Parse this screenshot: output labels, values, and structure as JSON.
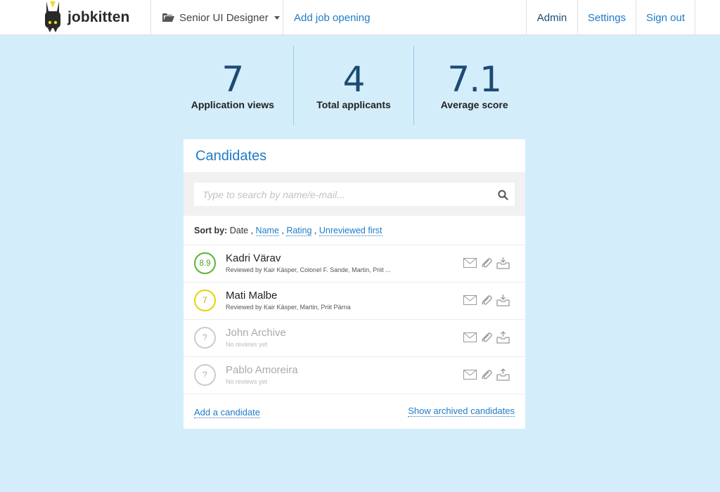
{
  "header": {
    "brand": "jobkitten",
    "job_selector": "Senior UI Designer",
    "add_job": "Add job opening",
    "admin": "Admin",
    "settings": "Settings",
    "sign_out": "Sign out"
  },
  "stats": [
    {
      "value": "7",
      "label": "Application views"
    },
    {
      "value": "4",
      "label": "Total applicants"
    },
    {
      "value": "7.1",
      "label": "Average score"
    }
  ],
  "candidates": {
    "title": "Candidates",
    "search_placeholder": "Type to search by name/e-mail...",
    "sort": {
      "label": "Sort by:",
      "current": "Date",
      "options": [
        "Name",
        "Rating",
        "Unreviewed first"
      ]
    },
    "rows": [
      {
        "score": "8.9",
        "score_color": "#5cb531",
        "name": "Kadri Värav",
        "sub": "Reviewed by Kair Käsper, Colonel F. Sande, Martin, Priit ..."
      },
      {
        "score": "7",
        "score_color": "#e5d20f",
        "name": "Mati Malbe",
        "sub": "Reviewed by Kair Käsper, Martin, Priit Pärna"
      },
      {
        "score": "?",
        "score_color": "#cccccc",
        "name": "John Archive",
        "sub": "No reviews yet"
      },
      {
        "score": "?",
        "score_color": "#cccccc",
        "name": "Pablo Amoreira",
        "sub": "No reviews yet"
      }
    ],
    "row_actions": [
      "email-icon",
      "paperclip-icon",
      "archive-icon"
    ],
    "add_candidate": "Add a candidate",
    "show_archived": "Show archived candidates"
  },
  "colors": {
    "background": "#d3edfb",
    "link": "#1f7bc6",
    "stat_value": "#1d4a73"
  }
}
